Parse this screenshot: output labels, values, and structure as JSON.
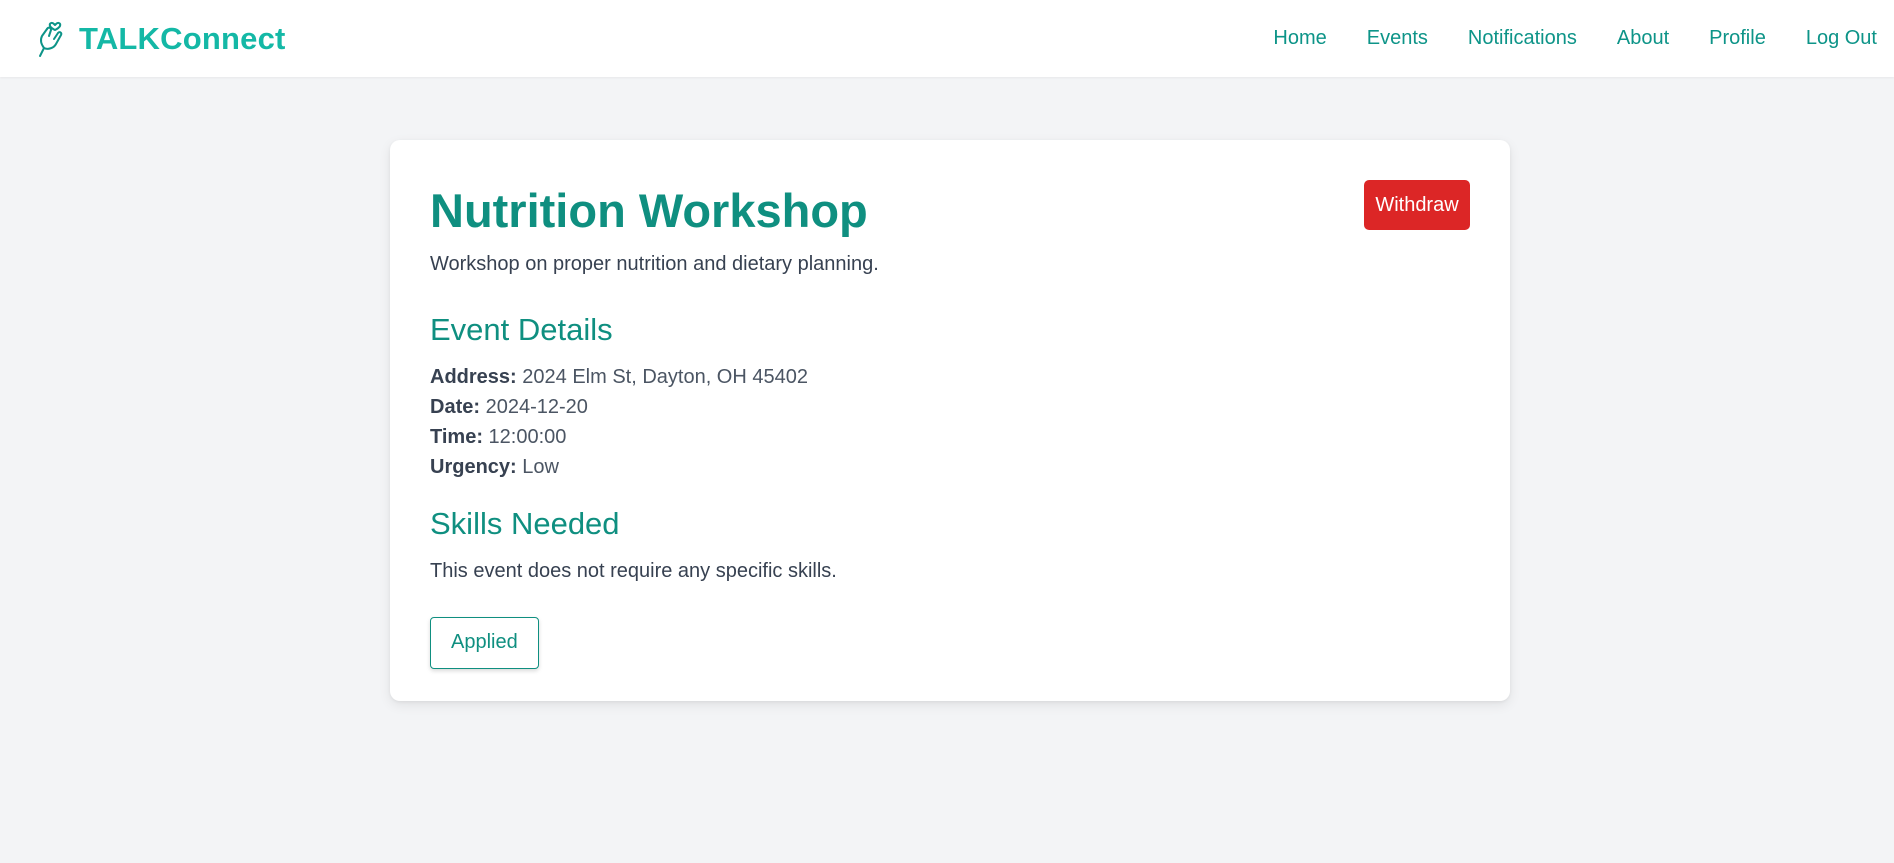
{
  "brand": {
    "name": "TALKConnect",
    "icon": "hand-heart-icon",
    "color": "#14b8a6"
  },
  "nav": {
    "items": [
      {
        "label": "Home"
      },
      {
        "label": "Events"
      },
      {
        "label": "Notifications"
      },
      {
        "label": "About"
      },
      {
        "label": "Profile"
      },
      {
        "label": "Log Out"
      }
    ],
    "color": "#0d9488"
  },
  "event": {
    "title": "Nutrition Workshop",
    "description": "Workshop on proper nutrition and dietary planning.",
    "withdraw_label": "Withdraw",
    "details_heading": "Event Details",
    "address_label": "Address:",
    "address": "2024 Elm St, Dayton, OH 45402",
    "date_label": "Date:",
    "date": "2024-12-20",
    "time_label": "Time:",
    "time": "12:00:00",
    "urgency_label": "Urgency:",
    "urgency": "Low",
    "skills_heading": "Skills Needed",
    "skills_text": "This event does not require any specific skills.",
    "applied_label": "Applied"
  },
  "colors": {
    "accent": "#0f8f80",
    "danger": "#dc2626",
    "background": "#f3f4f6"
  }
}
